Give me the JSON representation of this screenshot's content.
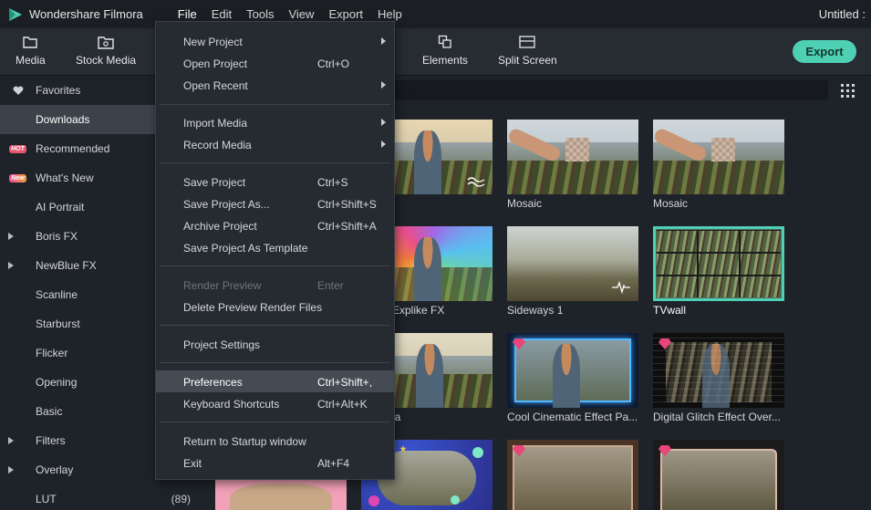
{
  "app": {
    "name": "Wondershare Filmora",
    "document_title": "Untitled :"
  },
  "menubar": [
    "File",
    "Edit",
    "Tools",
    "View",
    "Export",
    "Help"
  ],
  "toolbar": {
    "media": "Media",
    "stock_media": "Stock Media",
    "effects_fragment": "s",
    "elements": "Elements",
    "split_screen": "Split Screen",
    "export": "Export"
  },
  "sidebar": [
    {
      "label": "Favorites",
      "lead": "heart-icon",
      "count": ""
    },
    {
      "label": "Downloads",
      "lead": "",
      "count": ""
    },
    {
      "label": "Recommended",
      "lead": "HOT",
      "count": ""
    },
    {
      "label": "What's New",
      "lead": "New",
      "count": ""
    },
    {
      "label": "AI Portrait",
      "lead": "",
      "count": ""
    },
    {
      "label": "Boris FX",
      "lead": "expand",
      "count": ""
    },
    {
      "label": "NewBlue FX",
      "lead": "expand",
      "count": ""
    },
    {
      "label": "Scanline",
      "lead": "",
      "count": ""
    },
    {
      "label": "Starburst",
      "lead": "",
      "count": ""
    },
    {
      "label": "Flicker",
      "lead": "",
      "count": ""
    },
    {
      "label": "Opening",
      "lead": "",
      "count": ""
    },
    {
      "label": "Basic",
      "lead": "",
      "count": ""
    },
    {
      "label": "Filters",
      "lead": "expand",
      "count": ""
    },
    {
      "label": "Overlay",
      "lead": "expand",
      "count": ""
    },
    {
      "label": "LUT",
      "lead": "",
      "count": "(89)"
    }
  ],
  "effects": [
    {
      "label": "",
      "premium": false
    },
    {
      "label": "Mosaic",
      "premium": false
    },
    {
      "label": "Mosaic",
      "premium": false
    },
    {
      "label": "Explike FX",
      "premium": false
    },
    {
      "label": "Sideways 1",
      "premium": false
    },
    {
      "label": "TVwall",
      "premium": false,
      "selected": true
    },
    {
      "label": "ia",
      "premium": false
    },
    {
      "label": "Cool Cinematic Effect Pa...",
      "premium": true
    },
    {
      "label": "Digital Glitch Effect Over...",
      "premium": true
    }
  ],
  "file_menu": {
    "items": [
      {
        "label": "New Project",
        "shortcut": "",
        "submenu": true
      },
      {
        "label": "Open Project",
        "shortcut": "Ctrl+O"
      },
      {
        "label": "Open Recent",
        "shortcut": "",
        "submenu": true
      },
      {
        "label": "Import Media",
        "shortcut": "",
        "submenu": true
      },
      {
        "label": "Record Media",
        "shortcut": "",
        "submenu": true
      },
      {
        "label": "Save Project",
        "shortcut": "Ctrl+S"
      },
      {
        "label": "Save Project As...",
        "shortcut": "Ctrl+Shift+S"
      },
      {
        "label": "Archive Project",
        "shortcut": "Ctrl+Shift+A"
      },
      {
        "label": "Save Project As Template",
        "shortcut": ""
      },
      {
        "label": "Render Preview",
        "shortcut": "Enter",
        "disabled": true
      },
      {
        "label": "Delete Preview Render Files",
        "shortcut": ""
      },
      {
        "label": "Project Settings",
        "shortcut": ""
      },
      {
        "label": "Preferences",
        "shortcut": "Ctrl+Shift+,",
        "highlighted": true
      },
      {
        "label": "Keyboard Shortcuts",
        "shortcut": "Ctrl+Alt+K"
      },
      {
        "label": "Return to Startup window",
        "shortcut": ""
      },
      {
        "label": "Exit",
        "shortcut": "Alt+F4"
      }
    ]
  },
  "colors": {
    "accent": "#4ed0b4",
    "premium": "#e8457a"
  }
}
